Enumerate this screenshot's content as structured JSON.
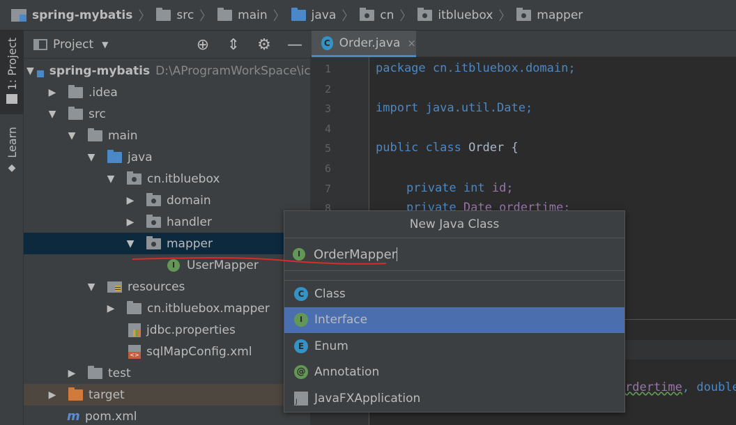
{
  "breadcrumb": {
    "project": "spring-mybatis",
    "items": [
      "src",
      "main",
      "java",
      "cn",
      "itbluebox",
      "mapper"
    ]
  },
  "toolstrip": {
    "project_tab": "1: Project",
    "learn_tab": "Learn"
  },
  "project_panel": {
    "title": "Project",
    "caret": "▼",
    "icons": [
      "target-icon",
      "collapse-icon",
      "gear-icon",
      "minimize-icon"
    ],
    "tree": [
      {
        "label": "spring-mybatis",
        "hint": "D:\\AProgramWorkSpace\\ic",
        "arrow": "▼"
      },
      {
        "label": ".idea",
        "arrow": "▶"
      },
      {
        "label": "src",
        "arrow": "▼"
      },
      {
        "label": "main",
        "arrow": "▼"
      },
      {
        "label": "java",
        "arrow": "▼"
      },
      {
        "label": "cn.itbluebox",
        "arrow": "▼"
      },
      {
        "label": "domain",
        "arrow": "▶"
      },
      {
        "label": "handler",
        "arrow": "▶"
      },
      {
        "label": "mapper",
        "arrow": "▼"
      },
      {
        "label": "UserMapper",
        "arrow": ""
      },
      {
        "label": "resources",
        "arrow": "▼"
      },
      {
        "label": "cn.itbluebox.mapper",
        "arrow": "▶"
      },
      {
        "label": "jdbc.properties",
        "arrow": ""
      },
      {
        "label": "sqlMapConfig.xml",
        "arrow": ""
      },
      {
        "label": "test",
        "arrow": "▶"
      },
      {
        "label": "target",
        "arrow": "▶"
      },
      {
        "label": "pom.xml",
        "arrow": ""
      }
    ]
  },
  "editor": {
    "tab_label": "Order.java",
    "tab_close": "×",
    "line_numbers": [
      "1",
      "2",
      "3",
      "4",
      "5",
      "6",
      "7",
      "8"
    ],
    "lines": {
      "l1_kw": "package ",
      "l1_rest": "cn.itbluebox.domain;",
      "l3_kw": "import ",
      "l3_rest": "java.util.Date;",
      "l5_kw": "public class ",
      "l5_rest": "Order {",
      "l7_kw": "private int ",
      "l7_rest": "id;",
      "l8_kw": "private ",
      "l8_rest": "Date ordertime;"
    },
    "peek_text": "rdertime",
    "peek_rest": ", double"
  },
  "dialog": {
    "title": "New Java Class",
    "input_value": "OrderMapper",
    "options": [
      {
        "label": "Class",
        "icon": "C"
      },
      {
        "label": "Interface",
        "icon": "I"
      },
      {
        "label": "Enum",
        "icon": "E"
      },
      {
        "label": "Annotation",
        "icon": "@"
      },
      {
        "label": "JavaFXApplication",
        "icon": ""
      }
    ],
    "selected_option": "Interface"
  },
  "colors": {
    "selection": "#4b6eaf",
    "tree_selection": "#0d293e",
    "accent_blue": "#4a88c7",
    "keyword": "#cc7832"
  }
}
